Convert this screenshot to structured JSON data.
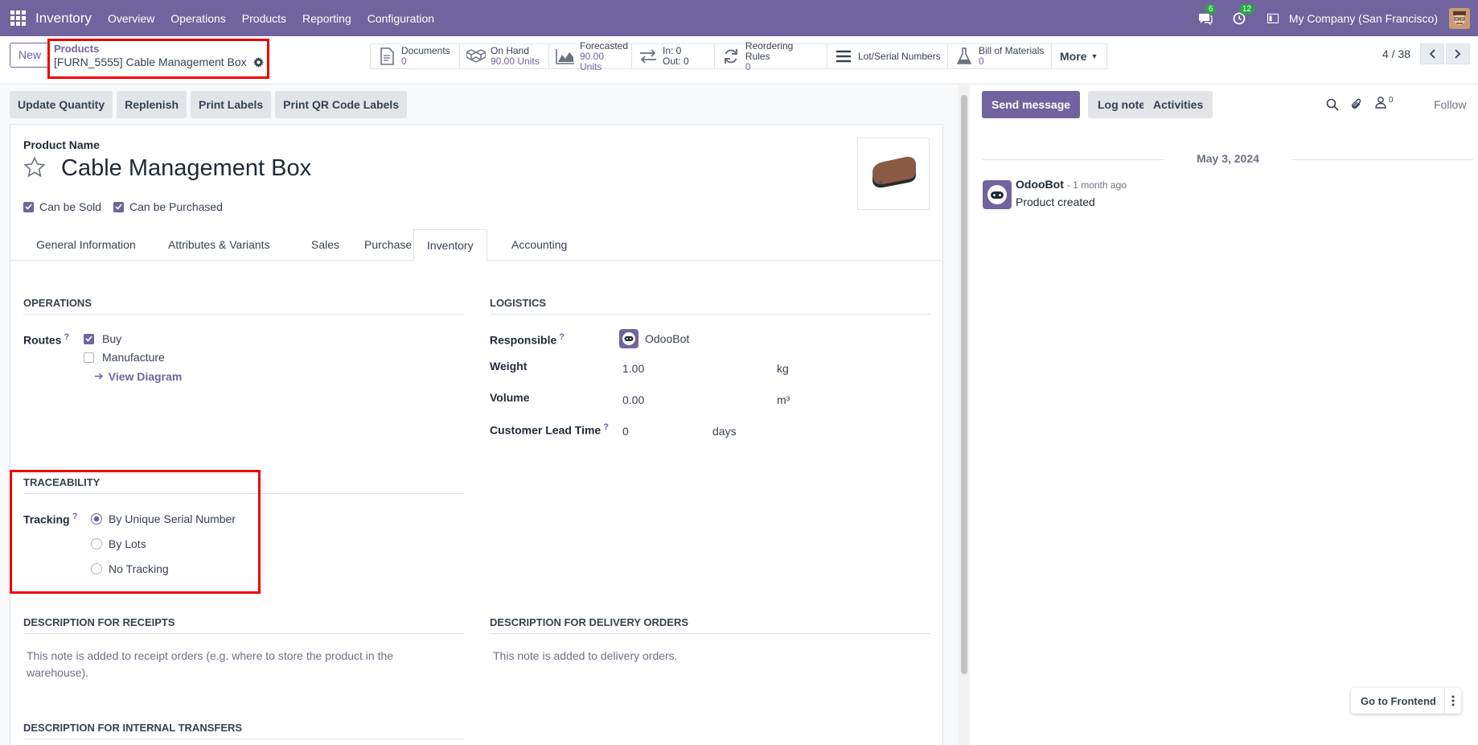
{
  "navbar": {
    "app_name": "Inventory",
    "menu": [
      "Overview",
      "Operations",
      "Products",
      "Reporting",
      "Configuration"
    ],
    "messages_count": "6",
    "activities_count": "12",
    "company": "My Company (San Francisco)"
  },
  "control_panel": {
    "new_label": "New",
    "breadcrumb_parent": "Products",
    "breadcrumb_current": "[FURN_5555] Cable Management Box",
    "stats": {
      "documents": {
        "label": "Documents",
        "value": "0"
      },
      "on_hand": {
        "label": "On Hand",
        "value": "90.00 Units"
      },
      "forecasted": {
        "label": "Forecasted",
        "value": "90.00 Units"
      },
      "in_out": {
        "in": "In: 0",
        "out": "Out: 0"
      },
      "reordering": {
        "label": "Reordering Rules",
        "value": "0"
      },
      "lots": {
        "label": "Lot/Serial Numbers"
      },
      "bom": {
        "label": "Bill of Materials",
        "value": "0"
      },
      "more": "More"
    },
    "pager": "4 / 38"
  },
  "statusbar": {
    "update_quantity": "Update Quantity",
    "replenish": "Replenish",
    "print_labels": "Print Labels",
    "print_qr": "Print QR Code Labels"
  },
  "form": {
    "product_name_label": "Product Name",
    "product_name": "Cable Management Box",
    "can_be_sold": "Can be Sold",
    "can_be_purchased": "Can be Purchased",
    "tabs": {
      "general": "General Information",
      "attributes": "Attributes & Variants",
      "sales": "Sales",
      "purchase": "Purchase",
      "inventory": "Inventory",
      "accounting": "Accounting"
    },
    "operations": {
      "title": "Operations",
      "routes_label": "Routes",
      "buy": "Buy",
      "manufacture": "Manufacture",
      "view_diagram": "View Diagram"
    },
    "logistics": {
      "title": "Logistics",
      "responsible_label": "Responsible",
      "responsible_value": "OdooBot",
      "weight_label": "Weight",
      "weight_value": "1.00",
      "weight_unit": "kg",
      "volume_label": "Volume",
      "volume_value": "0.00",
      "volume_unit": "m³",
      "lead_time_label": "Customer Lead Time",
      "lead_time_value": "0",
      "lead_time_unit": "days"
    },
    "traceability": {
      "title": "Traceability",
      "tracking_label": "Tracking",
      "serial": "By Unique Serial Number",
      "lots": "By Lots",
      "none": "No Tracking"
    },
    "desc_receipts": {
      "title": "Description for Receipts",
      "placeholder": "This note is added to receipt orders (e.g. where to store the product in the warehouse)."
    },
    "desc_delivery": {
      "title": "Description for Delivery Orders",
      "placeholder": "This note is added to delivery orders."
    },
    "desc_internal": {
      "title": "Description for Internal Transfers"
    }
  },
  "chatter": {
    "send_message": "Send message",
    "log_note": "Log note",
    "activities": "Activities",
    "followers_count": "0",
    "follow": "Follow",
    "date": "May 3, 2024",
    "message": {
      "author": "OdooBot",
      "time": "- 1 month ago",
      "body": "Product created"
    }
  },
  "floating": {
    "go_frontend": "Go to Frontend"
  },
  "colors": {
    "brand": "#71639e",
    "highlight": "#ee0000",
    "badge": "#28a745"
  }
}
